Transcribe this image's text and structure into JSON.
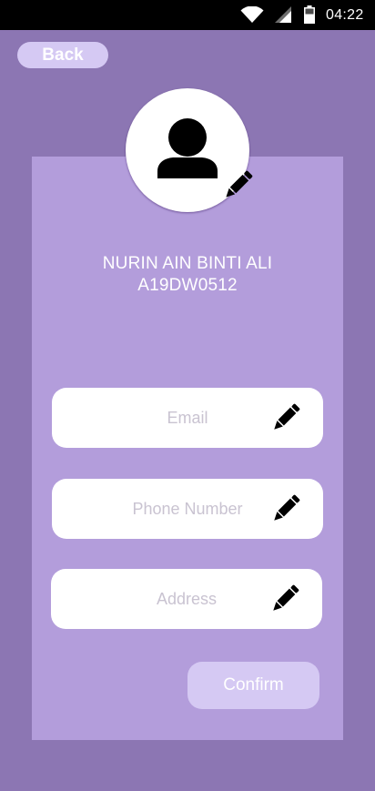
{
  "status_bar": {
    "time": "04:22",
    "icons": [
      "wifi-icon",
      "cellular-signal-icon",
      "battery-icon"
    ]
  },
  "header": {
    "back_label": "Back"
  },
  "profile": {
    "avatar_icon": "person-icon",
    "avatar_edit_icon": "pencil-icon",
    "name": "NURIN AIN BINTI ALI",
    "id": "A19DW0512"
  },
  "form": {
    "email": {
      "placeholder": "Email",
      "value": "",
      "icon": "pencil-icon"
    },
    "phone": {
      "placeholder": "Phone Number",
      "value": "",
      "icon": "pencil-icon"
    },
    "address": {
      "placeholder": "Address",
      "value": "",
      "icon": "pencil-icon"
    },
    "confirm_label": "Confirm"
  },
  "colors": {
    "background": "#8c76b3",
    "card": "#b39ddb",
    "button": "#d5c9f3",
    "field": "#ffffff",
    "placeholder": "#c9c3d1"
  }
}
